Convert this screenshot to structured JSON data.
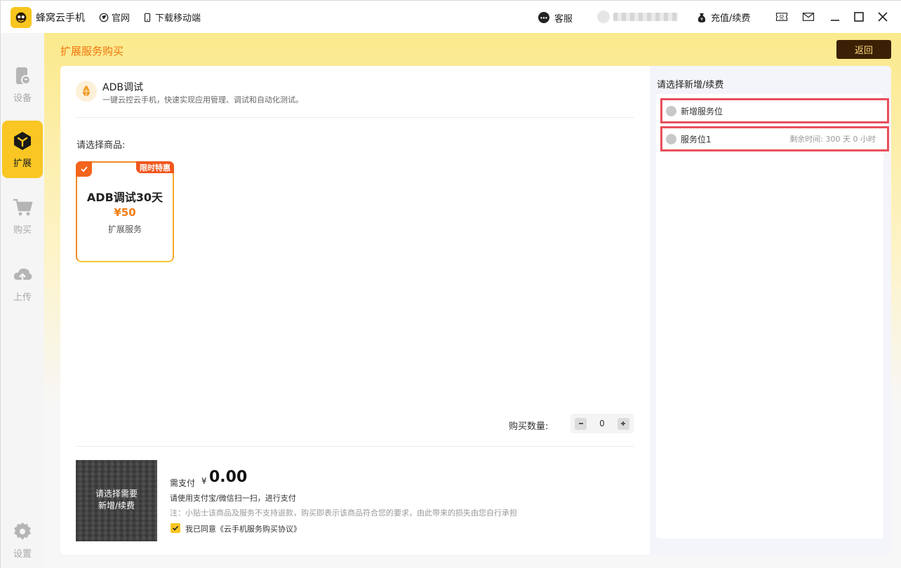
{
  "app": {
    "name": "蜂窝云手机",
    "links": [
      "官网",
      "下载移动端"
    ],
    "service_label": "客服",
    "recharge_label": "充值/续费"
  },
  "sidebar": {
    "items": [
      {
        "label": "设备",
        "icon": "phone-icon"
      },
      {
        "label": "扩展",
        "icon": "expand-cube-icon",
        "active": true
      },
      {
        "label": "购买",
        "icon": "cart-icon"
      },
      {
        "label": "上传",
        "icon": "upload-cloud-icon"
      },
      {
        "label": "设置",
        "icon": "gear-icon"
      }
    ]
  },
  "page": {
    "title": "扩展服务购买",
    "back_label": "返回"
  },
  "product": {
    "title": "ADB调试",
    "description": "一键云控云手机，快速实现应用管理、调试和自动化测试。",
    "select_label": "请选择商品:"
  },
  "goods": [
    {
      "name": "ADB调试30天",
      "price": "¥50",
      "type": "扩展服务",
      "badge": "限时特惠",
      "selected": true
    }
  ],
  "purchase": {
    "quantity_label": "购买数量:",
    "quantity": "0",
    "qr_text_line1": "请选择需要",
    "qr_text_line2": "新增/续费",
    "need_pay_label": "需支付",
    "currency": "¥",
    "amount": "0.00",
    "pay_hint": "请使用支付宝/微信扫一扫，进行支付",
    "note": "注：小贴士该商品及服务不支持退款，购买即表示该商品符合您的要求，由此带来的损失由您自行承担",
    "agreement": "我已同意《云手机服务购买协议》",
    "agreed": true
  },
  "slots": {
    "title": "请选择新增/续费",
    "options": [
      {
        "label": "新增服务位",
        "remaining": ""
      },
      {
        "label": "服务位1",
        "remaining": "剩余时间: 300 天 0 小时"
      }
    ]
  },
  "colors": {
    "accent": "#f9c623",
    "brand_orange": "#f07d14",
    "dark_button": "#3b2006",
    "highlight_border": "#e8505b"
  }
}
